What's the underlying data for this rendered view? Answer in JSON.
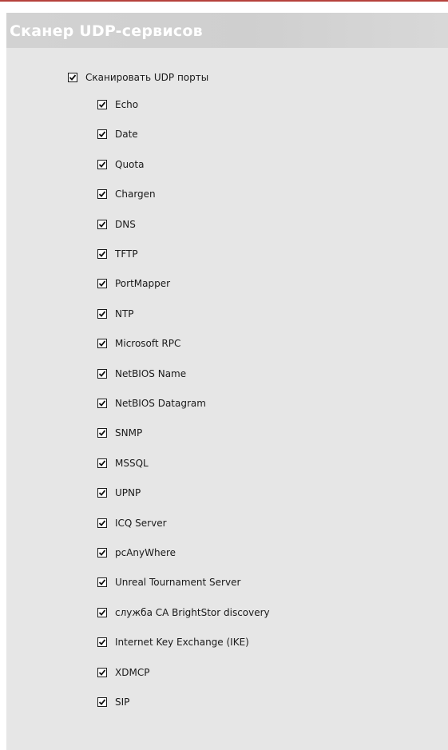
{
  "header": {
    "title": "Сканер UDP-сервисов"
  },
  "master": {
    "label": "Сканировать UDP порты",
    "checked": true
  },
  "services": [
    {
      "label": "Echo",
      "checked": true
    },
    {
      "label": "Date",
      "checked": true
    },
    {
      "label": "Quota",
      "checked": true
    },
    {
      "label": "Chargen",
      "checked": true
    },
    {
      "label": "DNS",
      "checked": true
    },
    {
      "label": "TFTP",
      "checked": true
    },
    {
      "label": "PortMapper",
      "checked": true
    },
    {
      "label": "NTP",
      "checked": true
    },
    {
      "label": "Microsoft RPC",
      "checked": true
    },
    {
      "label": "NetBIOS Name",
      "checked": true
    },
    {
      "label": "NetBIOS Datagram",
      "checked": true
    },
    {
      "label": "SNMP",
      "checked": true
    },
    {
      "label": "MSSQL",
      "checked": true
    },
    {
      "label": "UPNP",
      "checked": true
    },
    {
      "label": "ICQ Server",
      "checked": true
    },
    {
      "label": "pcAnyWhere",
      "checked": true
    },
    {
      "label": "Unreal Tournament Server",
      "checked": true
    },
    {
      "label": "служба CA BrightStor discovery",
      "checked": true
    },
    {
      "label": "Internet Key Exchange (IKE)",
      "checked": true
    },
    {
      "label": "XDMCP",
      "checked": true
    },
    {
      "label": "SIP",
      "checked": true
    }
  ],
  "colors": {
    "panel_bg": "#e6e6e6",
    "header_bg": "#d2d2d2",
    "header_text": "#ffffff",
    "top_rule": "#b5403b"
  }
}
